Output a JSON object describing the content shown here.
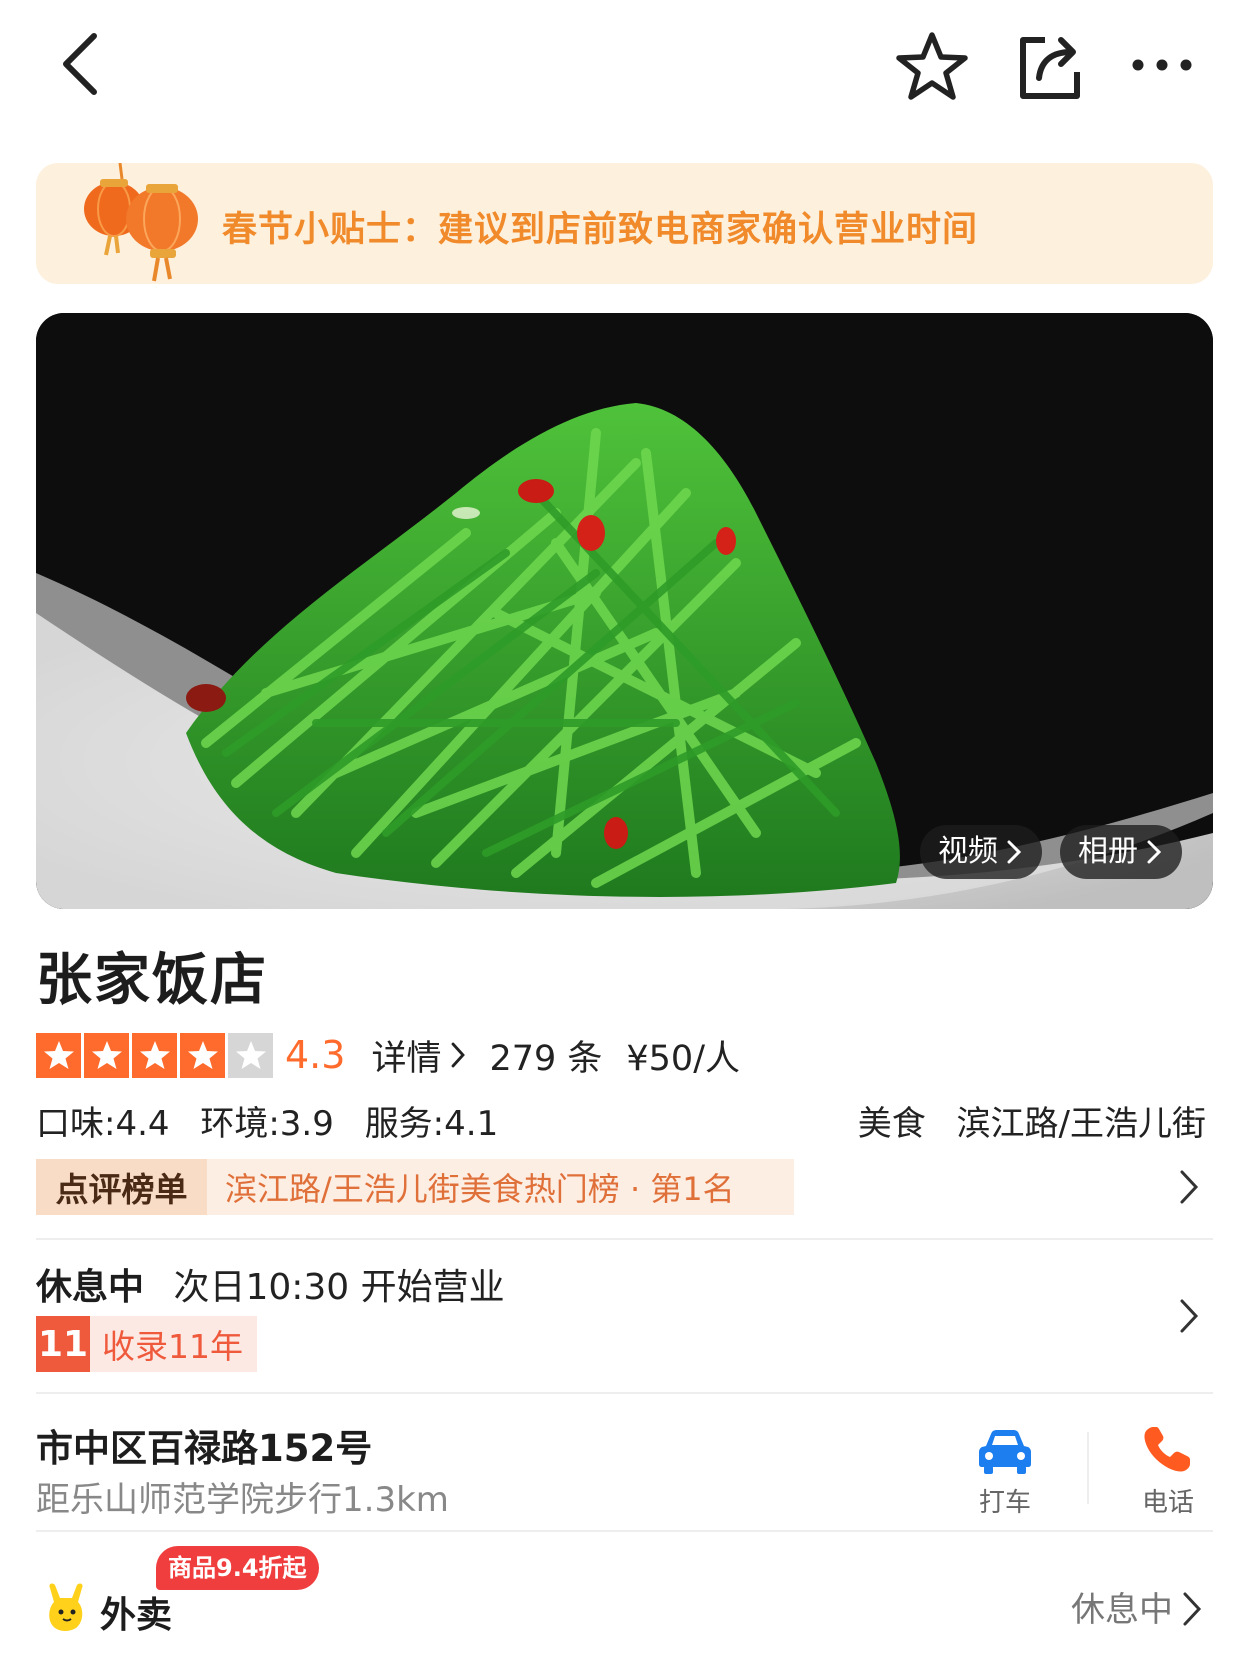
{
  "banner": {
    "text": "春节小贴士：建议到店前致电商家确认营业时间"
  },
  "hero": {
    "video_label": "视频",
    "album_label": "相册"
  },
  "shop": {
    "name": "张家饭店",
    "rating": {
      "stars_filled": 4,
      "stars_total": 5,
      "score": "4.3",
      "detail_label": "详情",
      "review_count": "279 条",
      "price": "¥50/人"
    },
    "sub_scores": {
      "taste": "口味:4.4",
      "environment": "环境:3.9",
      "service": "服务:4.1"
    },
    "category": "美食",
    "area": "滨江路/王浩儿街",
    "rank": {
      "tag": "点评榜单",
      "text": "滨江路/王浩儿街美食热门榜 · 第1名"
    },
    "hours": {
      "status": "休息中",
      "next_open": "次日10:30 开始营业"
    },
    "years": {
      "number": "11",
      "text": "收录11年"
    },
    "address": {
      "street": "市中区百禄路152号",
      "distance": "距乐山师范学院步行1.3km"
    }
  },
  "actions": {
    "taxi_label": "打车",
    "phone_label": "电话"
  },
  "takeout": {
    "label": "外卖",
    "badge": "商品9.4折起",
    "status": "休息中"
  },
  "colors": {
    "accent_orange": "#ff6b2c",
    "banner_bg": "#fdf0dc",
    "banner_text": "#f08a2a",
    "taxi_blue": "#1d7ef0",
    "phone_orange": "#ff5a1f",
    "badge_red": "#f03e3e"
  },
  "icons": [
    "back-icon",
    "star-outline-icon",
    "share-icon",
    "more-icon",
    "lantern-icon",
    "chevron-right-icon",
    "car-icon",
    "phone-icon",
    "takeout-logo-icon"
  ]
}
